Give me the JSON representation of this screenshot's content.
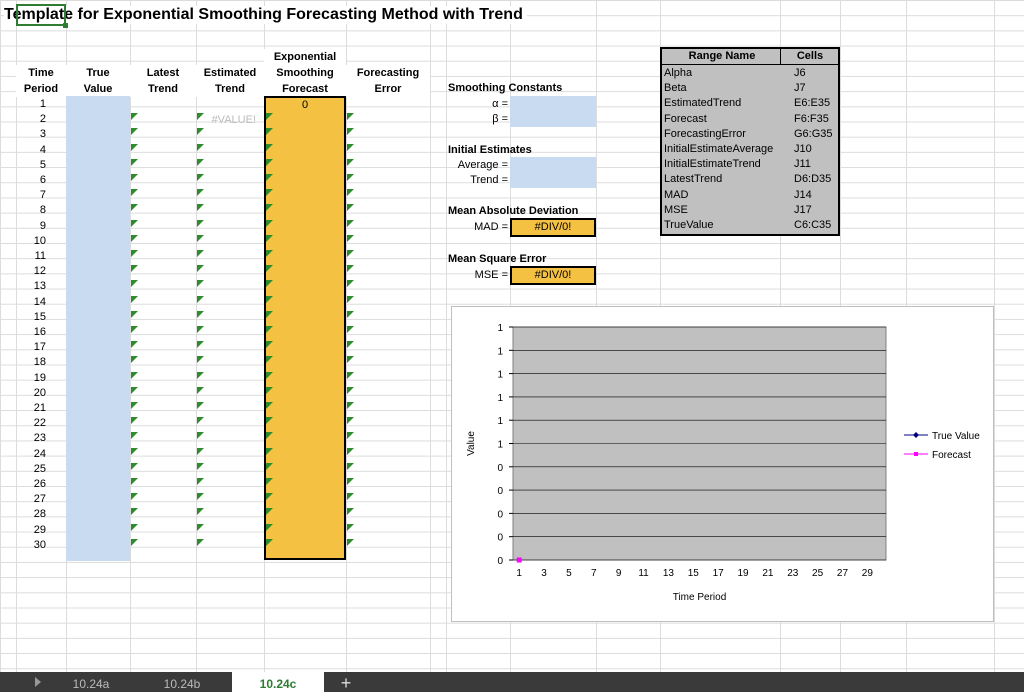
{
  "title": "Template for Exponential Smoothing Forecasting Method with Trend",
  "headers": {
    "time_period": [
      "Time",
      "Period"
    ],
    "true_value": [
      "True",
      "Value"
    ],
    "latest_trend": [
      "Latest",
      "Trend"
    ],
    "estimated_trend": [
      "Estimated",
      "Trend"
    ],
    "exp_forecast": [
      "Exponential",
      "Smoothing",
      "Forecast"
    ],
    "forecast_error": [
      "Forecasting",
      "Error"
    ]
  },
  "periods": [
    1,
    2,
    3,
    4,
    5,
    6,
    7,
    8,
    9,
    10,
    11,
    12,
    13,
    14,
    15,
    16,
    17,
    18,
    19,
    20,
    21,
    22,
    23,
    24,
    25,
    26,
    27,
    28,
    29,
    30
  ],
  "estimated_trend_first": "#VALUE!",
  "forecast_first": "0",
  "smoothing": {
    "heading": "Smoothing Constants",
    "alpha_label": "α =",
    "beta_label": "β ="
  },
  "initial": {
    "heading": "Initial Estimates",
    "average_label": "Average =",
    "trend_label": "Trend ="
  },
  "mad": {
    "heading": "Mean Absolute Deviation",
    "label": "MAD =",
    "value": "#DIV/0!"
  },
  "mse": {
    "heading": "Mean Square Error",
    "label": "MSE =",
    "value": "#DIV/0!"
  },
  "range_table": {
    "header_name": "Range Name",
    "header_cells": "Cells",
    "rows": [
      [
        "Alpha",
        "J6"
      ],
      [
        "Beta",
        "J7"
      ],
      [
        "EstimatedTrend",
        "E6:E35"
      ],
      [
        "Forecast",
        "F6:F35"
      ],
      [
        "ForecastingError",
        "G6:G35"
      ],
      [
        "InitialEstimateAverage",
        "J10"
      ],
      [
        "InitialEstimateTrend",
        "J11"
      ],
      [
        "LatestTrend",
        "D6:D35"
      ],
      [
        "MAD",
        "J14"
      ],
      [
        "MSE",
        "J17"
      ],
      [
        "TrueValue",
        "C6:C35"
      ]
    ]
  },
  "chart_data": {
    "type": "line",
    "xlabel": "Time Period",
    "ylabel": "Value",
    "x_ticks": [
      1,
      3,
      5,
      7,
      9,
      11,
      13,
      15,
      17,
      19,
      21,
      23,
      25,
      27,
      29
    ],
    "y_ticks": [
      "1",
      "1",
      "1",
      "1",
      "1",
      "1",
      "0",
      "0",
      "0",
      "0",
      "0"
    ],
    "series": [
      {
        "name": "True Value",
        "color": "#000080",
        "values": []
      },
      {
        "name": "Forecast",
        "color": "#ff00ff",
        "values": [
          0
        ]
      }
    ],
    "legend": "right"
  },
  "tabs": [
    {
      "label": "10.24a",
      "active": false
    },
    {
      "label": "10.24b",
      "active": false
    },
    {
      "label": "10.24c",
      "active": true
    },
    {
      "label": "+",
      "active": false
    }
  ]
}
